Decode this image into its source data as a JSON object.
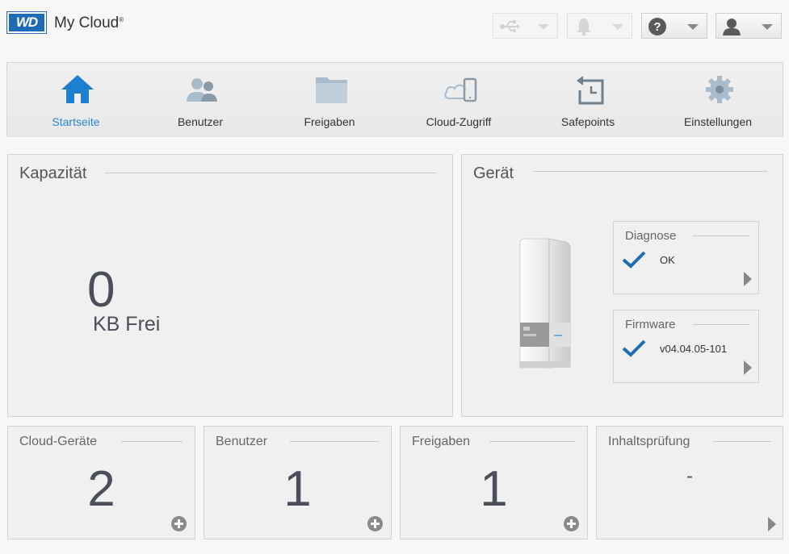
{
  "header": {
    "logo_text": "WD",
    "app_title": "My Cloud",
    "app_title_mark": "®",
    "buttons": [
      {
        "name": "usb-menu",
        "icon": "usb-icon",
        "enabled": false
      },
      {
        "name": "alerts-menu",
        "icon": "bell-icon",
        "enabled": false
      },
      {
        "name": "help-menu",
        "icon": "help-icon",
        "enabled": true
      },
      {
        "name": "user-menu",
        "icon": "user-icon",
        "enabled": true
      }
    ]
  },
  "nav": {
    "items": [
      {
        "label": "Startseite",
        "icon": "home-icon",
        "active": true
      },
      {
        "label": "Benutzer",
        "icon": "users-icon",
        "active": false
      },
      {
        "label": "Freigaben",
        "icon": "folder-icon",
        "active": false
      },
      {
        "label": "Cloud-Zugriff",
        "icon": "cloud-device-icon",
        "active": false
      },
      {
        "label": "Safepoints",
        "icon": "safepoint-icon",
        "active": false
      },
      {
        "label": "Einstellungen",
        "icon": "gear-icon",
        "active": false
      }
    ],
    "active_color": "#2b86d1",
    "home_icon_color": "#1e7fd0"
  },
  "capacity": {
    "title": "Kapazität",
    "value": "0",
    "unit": "KB Frei"
  },
  "device": {
    "title": "Gerät",
    "diagnose": {
      "title": "Diagnose",
      "value": "OK"
    },
    "firmware": {
      "title": "Firmware",
      "value": "v04.04.05-101"
    },
    "check_color": "#1e6db5"
  },
  "stats": [
    {
      "title": "Cloud-Geräte",
      "value": "2"
    },
    {
      "title": "Benutzer",
      "value": "1"
    },
    {
      "title": "Freigaben",
      "value": "1"
    },
    {
      "title": "Inhaltsprüfung",
      "value": "-"
    }
  ]
}
